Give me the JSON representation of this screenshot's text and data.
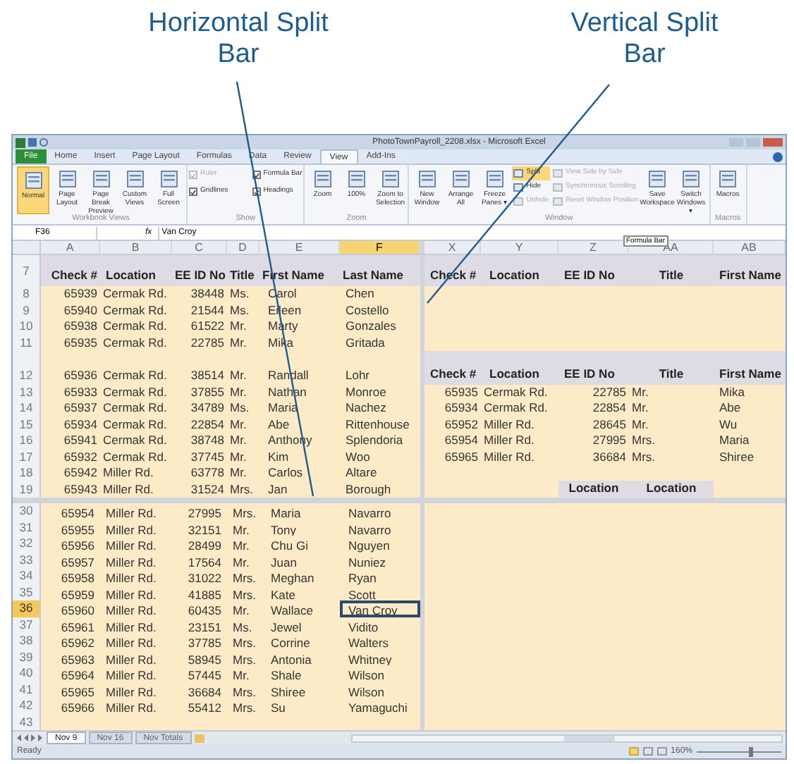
{
  "callouts": [
    {
      "label": "Horizontal Split Bar"
    },
    {
      "label": "Vertical Split Bar"
    }
  ],
  "window": {
    "title": "PhotoTownPayroll_2208.xlsx - Microsoft Excel"
  },
  "ribbon_tabs": [
    {
      "label": "File",
      "selected": false,
      "kind": "file"
    },
    {
      "label": "Home",
      "selected": false
    },
    {
      "label": "Insert",
      "selected": false
    },
    {
      "label": "Page Layout",
      "selected": false
    },
    {
      "label": "Formulas",
      "selected": false
    },
    {
      "label": "Data",
      "selected": false
    },
    {
      "label": "Review",
      "selected": false
    },
    {
      "label": "View",
      "selected": true
    },
    {
      "label": "Add-Ins",
      "selected": false
    }
  ],
  "ribbon_groups": [
    {
      "label": "Workbook Views",
      "columns": [
        [
          {
            "kind": "large",
            "label": "Normal",
            "selected": true
          }
        ],
        [
          {
            "kind": "large",
            "label": "Page Layout",
            "selected": false
          }
        ],
        [
          {
            "kind": "large",
            "label": "Page Break Preview",
            "selected": false
          }
        ],
        [
          {
            "kind": "large",
            "label": "Custom Views",
            "selected": false
          }
        ],
        [
          {
            "kind": "large",
            "label": "Full Screen",
            "selected": false
          }
        ]
      ]
    },
    {
      "label": "Show",
      "columns": [
        [
          {
            "kind": "check",
            "label": "Ruler",
            "checked": true,
            "disabled": true
          },
          {
            "kind": "check",
            "label": "Gridlines",
            "checked": true,
            "disabled": false
          }
        ],
        [
          {
            "kind": "check",
            "label": "Formula Bar",
            "checked": true,
            "disabled": false
          },
          {
            "kind": "check",
            "label": "Headings",
            "checked": true,
            "disabled": false
          }
        ]
      ]
    },
    {
      "label": "Zoom",
      "columns": [
        [
          {
            "kind": "large",
            "label": "Zoom",
            "selected": false
          }
        ],
        [
          {
            "kind": "large",
            "label": "100%",
            "selected": false
          }
        ],
        [
          {
            "kind": "large",
            "label": "Zoom to Selection",
            "selected": false
          }
        ]
      ]
    },
    {
      "label": "Window",
      "columns": [
        [
          {
            "kind": "large",
            "label": "New Window",
            "selected": false
          }
        ],
        [
          {
            "kind": "large",
            "label": "Arrange All",
            "selected": false
          }
        ],
        [
          {
            "kind": "large",
            "label": "Freeze Panes ▾",
            "selected": false
          }
        ],
        [
          {
            "kind": "small",
            "label": "Split",
            "selected": true,
            "disabled": false
          },
          {
            "kind": "small",
            "label": "Hide",
            "selected": false,
            "disabled": false
          },
          {
            "kind": "small",
            "label": "Unhide",
            "selected": false,
            "disabled": true
          }
        ],
        [
          {
            "kind": "small",
            "label": "View Side by Side",
            "selected": false,
            "disabled": true
          },
          {
            "kind": "small",
            "label": "Synchronous Scrolling",
            "selected": false,
            "disabled": true
          },
          {
            "kind": "small",
            "label": "Reset Window Position",
            "selected": false,
            "disabled": true
          }
        ],
        [
          {
            "kind": "large",
            "label": "Save Workspace",
            "selected": false
          }
        ],
        [
          {
            "kind": "large",
            "label": "Switch Windows ▾",
            "selected": false
          }
        ]
      ]
    },
    {
      "label": "Macros",
      "columns": [
        [
          {
            "kind": "large",
            "label": "Macros",
            "selected": false
          }
        ]
      ]
    }
  ],
  "formula_bar": {
    "name_box": "F36",
    "fx": "fx",
    "value": "Van Croy",
    "tooltip": "Formula Bar"
  },
  "columns_left": [
    {
      "label": "A",
      "selected": false
    },
    {
      "label": "B",
      "selected": false
    },
    {
      "label": "C",
      "selected": false
    },
    {
      "label": "D",
      "selected": false
    },
    {
      "label": "E",
      "selected": false
    },
    {
      "label": "F",
      "selected": true
    }
  ],
  "columns_right": [
    {
      "label": "X"
    },
    {
      "label": "Y"
    },
    {
      "label": "Z"
    },
    {
      "label": "AA"
    },
    {
      "label": "AB"
    }
  ],
  "top_left_pane": {
    "header_row": "7",
    "headers": [
      "Check #",
      "Location",
      "EE ID No",
      "Title",
      "First Name",
      "Last Name"
    ],
    "groups": [
      [
        {
          "row": "8",
          "cells": [
            "65939",
            "Cermak Rd.",
            "38448",
            "Ms.",
            "Carol",
            "Chen"
          ]
        },
        {
          "row": "9",
          "cells": [
            "65940",
            "Cermak Rd.",
            "21544",
            "Ms.",
            "Eileen",
            "Costello"
          ]
        },
        {
          "row": "10",
          "cells": [
            "65938",
            "Cermak Rd.",
            "61522",
            "Mr.",
            "Marty",
            "Gonzales"
          ]
        },
        {
          "row": "11",
          "cells": [
            "65935",
            "Cermak Rd.",
            "22785",
            "Mr.",
            "Mika",
            "Gritada"
          ]
        }
      ],
      [
        {
          "row": "12",
          "cells": [
            "65936",
            "Cermak Rd.",
            "38514",
            "Mr.",
            "Randall",
            "Lohr"
          ]
        },
        {
          "row": "13",
          "cells": [
            "65933",
            "Cermak Rd.",
            "37855",
            "Mr.",
            "Nathan",
            "Monroe"
          ]
        },
        {
          "row": "14",
          "cells": [
            "65937",
            "Cermak Rd.",
            "34789",
            "Ms.",
            "Maria",
            "Nachez"
          ]
        },
        {
          "row": "15",
          "cells": [
            "65934",
            "Cermak Rd.",
            "22854",
            "Mr.",
            "Abe",
            "Rittenhouse"
          ]
        },
        {
          "row": "16",
          "cells": [
            "65941",
            "Cermak Rd.",
            "38748",
            "Mr.",
            "Anthony",
            "Splendoria"
          ]
        },
        {
          "row": "17",
          "cells": [
            "65932",
            "Cermak Rd.",
            "37745",
            "Mr.",
            "Kim",
            "Woo"
          ]
        },
        {
          "row": "18",
          "cells": [
            "65942",
            "Miller Rd.",
            "63778",
            "Mr.",
            "Carlos",
            "Altare"
          ]
        },
        {
          "row": "19",
          "cells": [
            "65943",
            "Miller Rd.",
            "31524",
            "Mrs.",
            "Jan",
            "Borough"
          ]
        }
      ]
    ]
  },
  "top_right_pane": {
    "headers": [
      "Check #",
      "Location",
      "EE ID No",
      "Title",
      "First Name"
    ],
    "second_headers": [
      "Check #",
      "Location",
      "EE ID No",
      "Title",
      "First Name"
    ],
    "rows": [
      [
        "65935",
        "Cermak Rd.",
        "22785",
        "Mr.",
        "Mika"
      ],
      [
        "65934",
        "Cermak Rd.",
        "22854",
        "Mr.",
        "Abe"
      ],
      [
        "65952",
        "Miller Rd.",
        "28645",
        "Mr.",
        "Wu"
      ],
      [
        "65954",
        "Miller Rd.",
        "27995",
        "Mrs.",
        "Maria"
      ],
      [
        "65965",
        "Miller Rd.",
        "36684",
        "Mrs.",
        "Shiree"
      ]
    ],
    "footer_headers": [
      "Location",
      "Location"
    ]
  },
  "bottom_left_pane": {
    "rows": [
      {
        "row": "30",
        "selected": false,
        "cells": [
          "65954",
          "Miller Rd.",
          "27995",
          "Mrs.",
          "Maria",
          "Navarro"
        ]
      },
      {
        "row": "31",
        "selected": false,
        "cells": [
          "65955",
          "Miller Rd.",
          "32151",
          "Mr.",
          "Tony",
          "Navarro"
        ]
      },
      {
        "row": "32",
        "selected": false,
        "cells": [
          "65956",
          "Miller Rd.",
          "28499",
          "Mr.",
          "Chu Gi",
          "Nguyen"
        ]
      },
      {
        "row": "33",
        "selected": false,
        "cells": [
          "65957",
          "Miller Rd.",
          "17564",
          "Mr.",
          "Juan",
          "Nuniez"
        ]
      },
      {
        "row": "34",
        "selected": false,
        "cells": [
          "65958",
          "Miller Rd.",
          "31022",
          "Mrs.",
          "Meghan",
          "Ryan"
        ]
      },
      {
        "row": "35",
        "selected": false,
        "cells": [
          "65959",
          "Miller Rd.",
          "41885",
          "Mrs.",
          "Kate",
          "Scott"
        ]
      },
      {
        "row": "36",
        "selected": true,
        "cells": [
          "65960",
          "Miller Rd.",
          "60435",
          "Mr.",
          "Wallace",
          "Van Croy"
        ]
      },
      {
        "row": "37",
        "selected": false,
        "cells": [
          "65961",
          "Miller Rd.",
          "23151",
          "Ms.",
          "Jewel",
          "Vidito"
        ]
      },
      {
        "row": "38",
        "selected": false,
        "cells": [
          "65962",
          "Miller Rd.",
          "37785",
          "Mrs.",
          "Corrine",
          "Walters"
        ]
      },
      {
        "row": "39",
        "selected": false,
        "cells": [
          "65963",
          "Miller Rd.",
          "58945",
          "Mrs.",
          "Antonia",
          "Whitney"
        ]
      },
      {
        "row": "40",
        "selected": false,
        "cells": [
          "65964",
          "Miller Rd.",
          "57445",
          "Mr.",
          "Shale",
          "Wilson"
        ]
      },
      {
        "row": "41",
        "selected": false,
        "cells": [
          "65965",
          "Miller Rd.",
          "36684",
          "Mrs.",
          "Shiree",
          "Wilson"
        ]
      },
      {
        "row": "42",
        "selected": false,
        "cells": [
          "65966",
          "Miller Rd.",
          "55412",
          "Mrs.",
          "Su",
          "Yamaguchi"
        ]
      },
      {
        "row": "43",
        "selected": false,
        "cells": []
      }
    ]
  },
  "sheet_tabs": [
    {
      "label": "Nov 9",
      "selected": true
    },
    {
      "label": "Nov 16",
      "selected": false
    },
    {
      "label": "Nov Totals",
      "selected": false
    }
  ],
  "status_bar": {
    "text": "Ready",
    "zoom": "160%",
    "zoom_slider": {
      "level": 0.62
    }
  }
}
